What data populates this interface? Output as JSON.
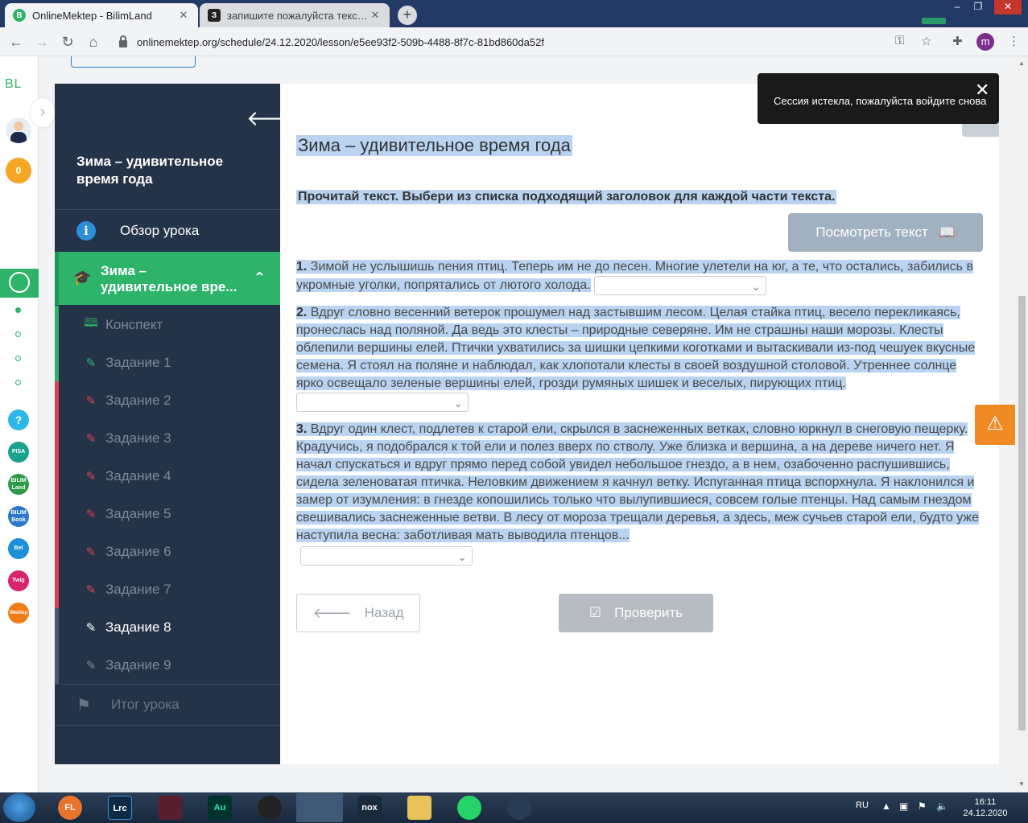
{
  "browser": {
    "tabs": [
      {
        "title": "OnlineMektep - BilimLand",
        "favicon": "B"
      },
      {
        "title": "запишите пожалуйста текст-он...",
        "favicon": "З"
      }
    ],
    "url": "onlinemektep.org/schedule/24.12.2020/lesson/e5ee93f2-509b-4488-8f7c-81bd860da52f",
    "profile_initial": "m"
  },
  "rail": {
    "logo": "BL",
    "score": "0",
    "apps": [
      "?",
      "PISA",
      "BILIM Land",
      "BILIM Book",
      "Bel",
      "Twig",
      "iMektep"
    ]
  },
  "sidebar": {
    "lesson_title": "Зима – удивительное время года",
    "overview_label": "Обзор урока",
    "current_section_line1": "Зима –",
    "current_section_line2": "удивительное вре...",
    "items": [
      {
        "label": "Конспект"
      },
      {
        "label": "Задание 1"
      },
      {
        "label": "Задание 2"
      },
      {
        "label": "Задание 3"
      },
      {
        "label": "Задание 4"
      },
      {
        "label": "Задание 5"
      },
      {
        "label": "Задание 6"
      },
      {
        "label": "Задание 7"
      },
      {
        "label": "Задание 8"
      },
      {
        "label": "Задание 9"
      }
    ],
    "summary_label": "Итог урока"
  },
  "content": {
    "title": "Зима – удивительное время года",
    "instruction": "Прочитай текст. Выбери из списка подходящий заголовок для каждой части текста.",
    "view_text_label": "Посмотреть текст",
    "parts": [
      {
        "num": "1.",
        "text": " Зимой не услышишь пения птиц. Теперь им не до песен. Многие улетели на юг, а те, что остались, забились в укромные уголки, попрятались от лютого холода."
      },
      {
        "num": "2.",
        "text": " Вдруг словно весенний ветерок прошумел над застывшим лесом. Целая стайка птиц, весело перекликаясь, пронеслась над поляной. Да ведь это клесты – природные северяне. Им не страшны наши морозы. Клесты облепили вершины елей. Птички ухватились за шишки цепкими коготками и вытаскивали из-под чешуек вкусные семена. Я стоял на поляне и наблюдал, как хлопотали клесты в своей воздушной столовой. Утреннее солнце ярко освещало зеленые вершины елей, грозди румяных шишек и веселых, пирующих птиц."
      },
      {
        "num": "3.",
        "text": " Вдруг один клест, подлетев к старой ели, скрылся в заснеженных ветках, словно юркнул в снеговую пещерку. Крадучись, я подобрался к той ели и полез вверх по стволу. Уже близка и вершина, а на дереве ничего нет. Я начал спускаться и вдруг прямо перед собой увидел небольшое гнездо, а в нем, озабоченно распушившись, сидела зеленоватая птичка. Неловким движением я качнул ветку. Испуганная птица вспорхнула. Я наклонился и замер от изумления: в гнезде копошились только что вылупившиеся, совсем голые птенцы. Над самым гнездом свешивались заснеженные ветви. В лесу от мороза трещали деревья, а здесь, меж сучьев старой ели, будто уже наступила весна: заботливая мать выводила птенцов..."
      }
    ],
    "back_label": "Назад",
    "check_label": "Проверить"
  },
  "toast": {
    "message": "Сессия истекла, пожалуйста войдите снова"
  },
  "taskbar": {
    "apps": [
      "FL",
      "Lrc",
      "",
      "Au",
      "",
      "",
      "nox",
      "",
      "",
      ""
    ],
    "lang": "RU",
    "time": "16:11",
    "date": "24.12.2020"
  },
  "colors": {
    "accent_green": "#2db36a",
    "sidebar_bg": "#253348",
    "error_red": "#d9434f",
    "selection": "#b9d3f0"
  }
}
